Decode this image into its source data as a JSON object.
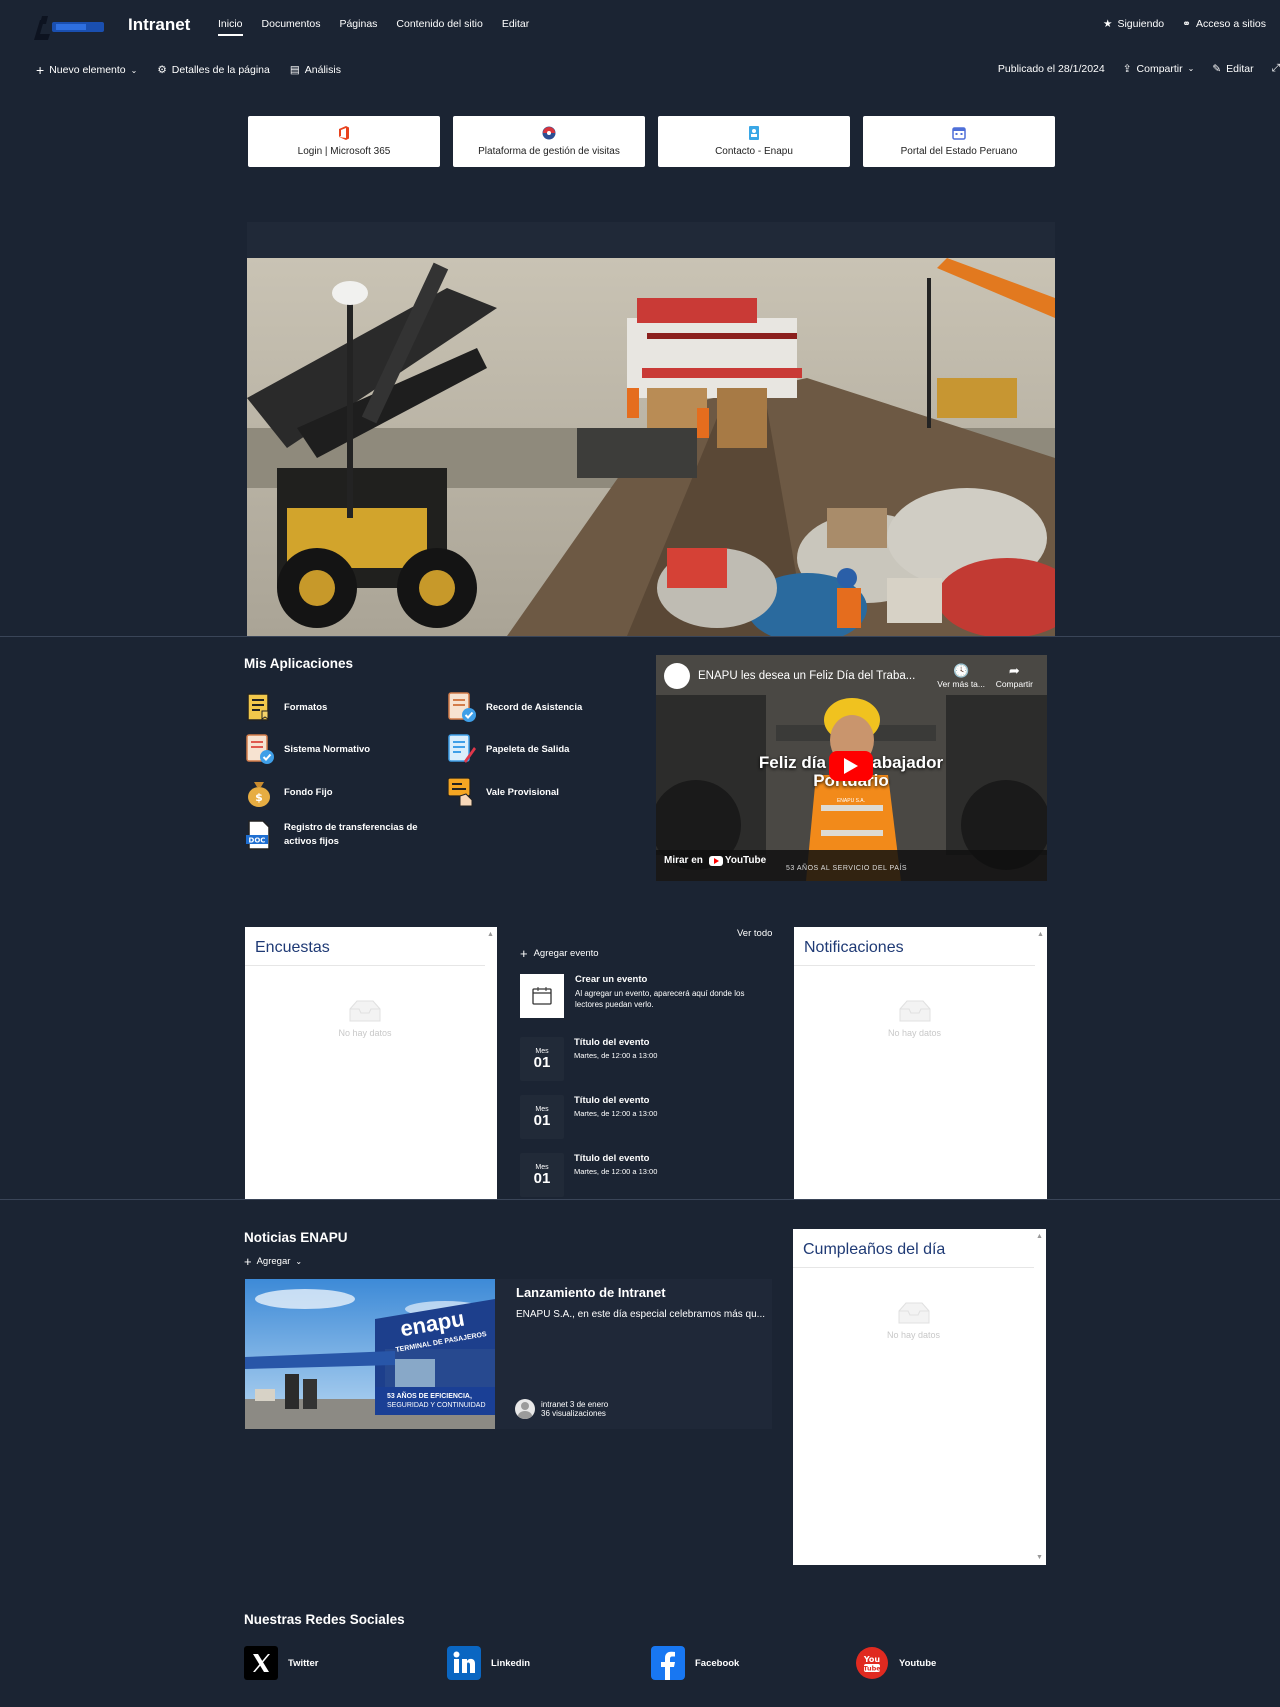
{
  "header": {
    "site_title": "Intranet",
    "nav": [
      "Inicio",
      "Documentos",
      "Páginas",
      "Contenido del sitio",
      "Editar"
    ],
    "following": "Siguiendo",
    "site_access": "Acceso a sitios"
  },
  "commandbar": {
    "new_item": "Nuevo elemento",
    "page_details": "Detalles de la página",
    "analytics": "Análisis",
    "published": "Publicado el 28/1/2024",
    "share": "Compartir",
    "edit": "Editar"
  },
  "quick_links": [
    {
      "label": "Login | Microsoft 365",
      "icon": "office-icon"
    },
    {
      "label": "Plataforma de gestión de visitas",
      "icon": "globe-icon"
    },
    {
      "label": "Contacto - Enapu",
      "icon": "contact-icon"
    },
    {
      "label": "Portal del Estado Peruano",
      "icon": "calendar-icon"
    }
  ],
  "apps": {
    "title": "Mis Aplicaciones",
    "items": [
      {
        "label": "Formatos",
        "icon": "forms-icon"
      },
      {
        "label": "Record de Asistencia",
        "icon": "attendance-icon"
      },
      {
        "label": "Sistema Normativo",
        "icon": "rules-icon"
      },
      {
        "label": "Papeleta de Salida",
        "icon": "exit-slip-icon"
      },
      {
        "label": "Fondo Fijo",
        "icon": "money-bag-icon"
      },
      {
        "label": "Vale Provisional",
        "icon": "voucher-icon"
      },
      {
        "label": "Registro de transferencias de activos fijos",
        "icon": "doc-icon"
      }
    ]
  },
  "video": {
    "title": "ENAPU les desea un Feliz Día del Traba...",
    "watch_later": "Ver más ta...",
    "share": "Compartir",
    "caption": "Feliz día del trabajador Portuario",
    "brand": "ENAPU S.A.",
    "watch_on": "Mirar en",
    "youtube": "YouTube",
    "footer": "53 AÑOS AL SERVICIO DEL PAÍS"
  },
  "surveys": {
    "title": "Encuestas",
    "empty": "No hay datos"
  },
  "notifications": {
    "title": "Notificaciones",
    "empty": "No hay datos"
  },
  "events": {
    "see_all": "Ver todo",
    "add": "Agregar evento",
    "create_title": "Crear un evento",
    "create_desc": "Al agregar un evento, aparecerá aquí donde los lectores puedan verlo.",
    "items": [
      {
        "month": "Mes",
        "day": "01",
        "title": "Título del evento",
        "time": "Martes, de 12:00 a 13:00"
      },
      {
        "month": "Mes",
        "day": "01",
        "title": "Título del evento",
        "time": "Martes, de 12:00 a 13:00"
      },
      {
        "month": "Mes",
        "day": "01",
        "title": "Título del evento",
        "time": "Martes, de 12:00 a 13:00"
      }
    ]
  },
  "news": {
    "title": "Noticias ENAPU",
    "add": "Agregar",
    "card": {
      "title": "Lanzamiento de Intranet",
      "excerpt": "ENAPU S.A., en este día especial celebramos más qu...",
      "author": "intranet",
      "date": "3 de enero",
      "views": "36 visualizaciones",
      "image_sign": "enapu",
      "image_sub": "TERMINAL DE PASAJEROS",
      "image_banner1": "53 AÑOS DE EFICIENCIA,",
      "image_banner2": "SEGURIDAD Y CONTINUIDAD"
    }
  },
  "birthdays": {
    "title": "Cumpleaños del día",
    "empty": "No hay datos"
  },
  "social": {
    "title": "Nuestras Redes Sociales",
    "items": [
      {
        "label": "Twitter",
        "icon": "x-twitter-icon"
      },
      {
        "label": "Linkedin",
        "icon": "linkedin-icon"
      },
      {
        "label": "Facebook",
        "icon": "facebook-icon"
      },
      {
        "label": "Youtube",
        "icon": "youtube-icon"
      }
    ]
  },
  "colors": {
    "background": "#1b2433",
    "panel": "#ffffff",
    "panel_title": "#1f3a75",
    "office": "#e8421d",
    "linkedin": "#0a66c2",
    "facebook": "#1877f2",
    "youtube": "#e02a20"
  }
}
